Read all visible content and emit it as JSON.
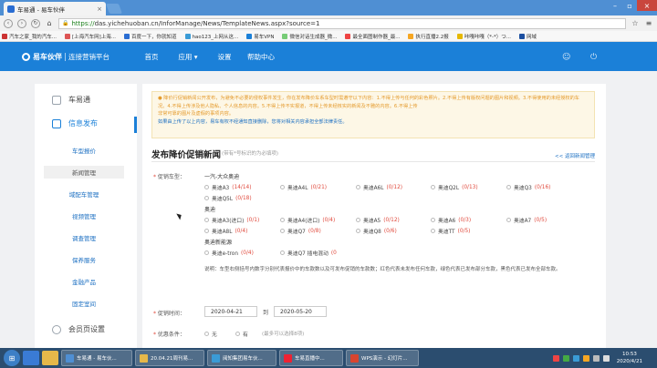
{
  "browser": {
    "tab_title": "车易通 - 易车伙伴",
    "url_scheme": "https://",
    "url_rest": "das.yichehuoban.cn/InforManage/News/TemplateNews.aspx?source=1",
    "bookmarks": [
      "汽车之家_我的汽车...",
      "[上海汽车网]上海...",
      "百度一下，你就知道",
      "hao123_上网从这...",
      "易车VPN",
      "微信对话生成器_微...",
      "最全面图制作器_最...",
      "执行直播2.2报",
      "咔嘎咔嘎（*-*）つ...",
      "网域"
    ]
  },
  "site": {
    "logo_name": "易车伙伴",
    "logo_sub": "连接营销平台",
    "nav": [
      "首页",
      "应用 ▾",
      "设置",
      "帮助中心"
    ]
  },
  "sidebar": {
    "sections": [
      {
        "label": "车易通"
      },
      {
        "label": "信息发布"
      }
    ],
    "items": [
      "车型报价",
      "新闻管理",
      "域配车管理",
      "视频管理",
      "调查管理",
      "保养服务",
      "金融产品",
      "固定室间"
    ],
    "bottom": "会员页设置"
  },
  "notice": {
    "line1": "● 降价行促销新闻公开发布，为避免不必要的侵权事件发生，你在发布降价车系车型时需遵守以下内容：1.不得上传与任何的彩色照片。2.不得上传有版权问题的图片和视频。3.不得使用的未经授权的车况。4.不得上传涉及他人隐私、个人信息的内容。5.不得上传不实报道，不得上传未经核实的新闻及不雅的内容。6.不得上传",
    "line2": "非常可靠的图片及虚假的事项内容。",
    "line3": "如果由上传了以上内容，易车有权不经通知直接删除，您将对相关内容承担全部法律责任。"
  },
  "form": {
    "title": "发布降价促销新闻",
    "subtitle": "(带有*号标识的为必填项)",
    "back_link": "<< 返回新闻管理",
    "model_label": "促销车型：",
    "groups": [
      {
        "name": "一汽-大众奥迪",
        "options": [
          {
            "name": "奥迪A3",
            "count": "(14/14)"
          },
          {
            "name": "奥迪A4L",
            "count": "(0/21)"
          },
          {
            "name": "奥迪A6L",
            "count": "(0/12)"
          },
          {
            "name": "奥迪Q2L",
            "count": "(0/13)"
          },
          {
            "name": "奥迪Q3",
            "count": "(0/16)"
          },
          {
            "name": "奥迪Q5L",
            "count": "(0/18)"
          }
        ]
      },
      {
        "name": "奥迪",
        "options": [
          {
            "name": "奥迪A3(进口)",
            "count": "(0/1)"
          },
          {
            "name": "奥迪A4(进口)",
            "count": "(0/4)"
          },
          {
            "name": "奥迪A5",
            "count": "(0/12)"
          },
          {
            "name": "奥迪A6",
            "count": "(0/3)"
          },
          {
            "name": "奥迪A7",
            "count": "(0/5)"
          },
          {
            "name": "奥迪A8L",
            "count": "(0/4)"
          },
          {
            "name": "奥迪Q7",
            "count": "(0/8)"
          },
          {
            "name": "奥迪Q8",
            "count": "(0/6)"
          },
          {
            "name": "奥迪TT",
            "count": "(0/5)"
          }
        ]
      },
      {
        "name": "奥迪新能源",
        "options": [
          {
            "name": "奥迪e-tron",
            "count": "(0/4)"
          },
          {
            "name": "奥迪Q7 插电混动",
            "count": "(0"
          }
        ]
      }
    ],
    "explain": "说明：车型右侧括号内数字分别代表报价中的车款数以及可发布促销的车款数；红色代表未发布任何车款，绿色代表已发布部分车款，黑色代表已发布全部车款。",
    "period_label": "促销时间：",
    "start_date": "2020-04-21",
    "to_label": "到",
    "end_date": "2020-05-20",
    "offer_label": "优惠条件：",
    "offer_hint": "(最多可以选择8项)"
  },
  "taskbar": {
    "tasks": [
      "车易通 - 易车伙...",
      "20.04.21周刊易...",
      "阅知集团易车伙...",
      "车易直播中...",
      "WPS演示 - 幻灯片..."
    ],
    "time": "10:53",
    "date": "2020/4/21"
  }
}
